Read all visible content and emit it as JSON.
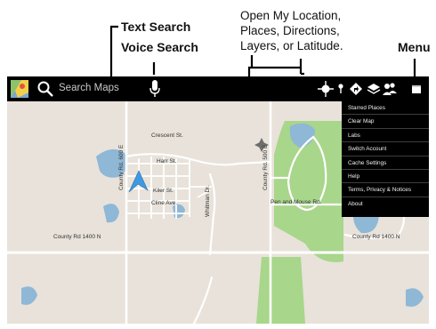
{
  "callouts": {
    "text_search": "Text Search",
    "voice_search": "Voice Search",
    "toolbar_line1": "Open My Location,",
    "toolbar_line2": "Places, Directions,",
    "toolbar_line3": "Layers, or Latitude.",
    "menu": "Menu"
  },
  "toolbar": {
    "search_placeholder": "Search Maps",
    "icons": [
      "app-icon",
      "search-icon",
      "microphone-icon",
      "my-location-icon",
      "places-icon",
      "directions-icon",
      "layers-icon",
      "latitude-icon",
      "menu-icon"
    ]
  },
  "map": {
    "streets": {
      "crescent": "Crescent St.",
      "harr": "Harr St.",
      "kiler": "Kiler St.",
      "cline": "Cline Ave.",
      "county_600e": "County Rd. 600 E",
      "whitman": "Whitman Dr.",
      "county_500e": "County Rd. 500 E",
      "pen_mouse": "Pen and Mouse Rd.",
      "county_1400n_left": "County Rd 1400 N",
      "county_1400n_right": "County Rd 1400 N"
    }
  },
  "menu": {
    "items": [
      {
        "label": "Starred Places"
      },
      {
        "label": "Clear Map"
      },
      {
        "label": "Labs"
      },
      {
        "label": "Switch Account"
      },
      {
        "label": "Cache Settings"
      },
      {
        "label": "Help"
      },
      {
        "label": "Terms, Privacy & Notices"
      },
      {
        "label": "About"
      }
    ]
  },
  "colors": {
    "toolbar": "#000000",
    "map_land": "#e8e2da",
    "water": "#8fb7d6",
    "park": "#a8d68b",
    "road": "#ffffff",
    "location_arrow": "#3f9ae0"
  }
}
